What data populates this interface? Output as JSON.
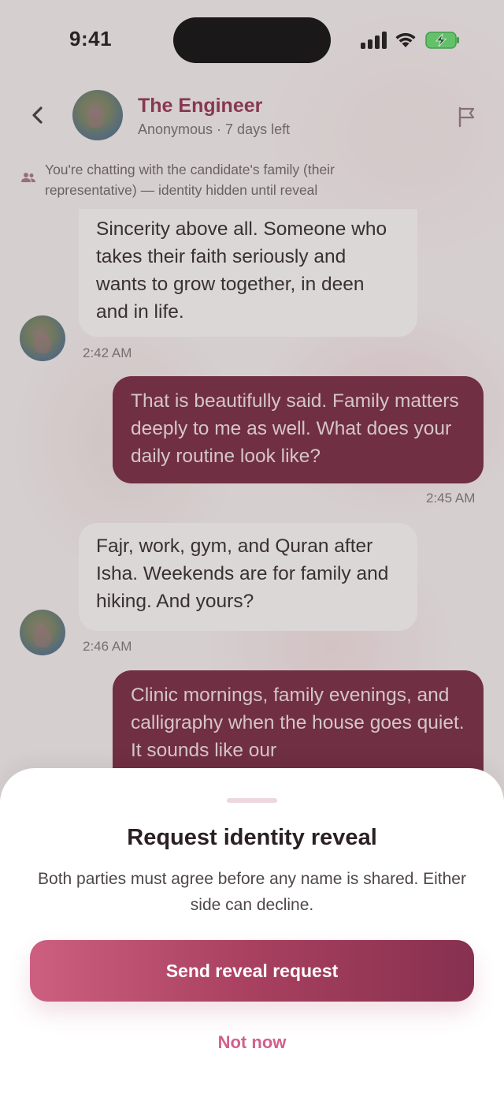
{
  "status_bar": {
    "time": "9:41"
  },
  "header": {
    "name": "The Engineer",
    "subtitle": "Anonymous · 7 days left"
  },
  "notice": {
    "text": "You're chatting with the candidate's family (their representative) — identity hidden until reveal"
  },
  "messages": [
    {
      "direction": "incoming",
      "text": "Sincerity above all. Someone who takes their faith seriously and wants to grow together, in deen and in life.",
      "time": "2:42 AM"
    },
    {
      "direction": "outgoing",
      "text": "That is beautifully said. Family matters deeply to me as well. What does your daily routine look like?",
      "time": "2:45 AM"
    },
    {
      "direction": "incoming",
      "text": "Fajr, work, gym, and Quran after Isha. Weekends are for family and hiking. And yours?",
      "time": "2:46 AM"
    },
    {
      "direction": "outgoing",
      "text": "Clinic mornings, family evenings, and calligraphy when the house goes quiet. It sounds like our"
    }
  ],
  "sheet": {
    "title": "Request identity reveal",
    "description": "Both parties must agree before any name is shared. Either side can decline.",
    "primary_label": "Send reveal request",
    "secondary_label": "Not now"
  },
  "colors": {
    "accent": "#8a2d4a",
    "outgoing_bubble": "#6e2239",
    "incoming_bubble": "#f2eeee",
    "button_gradient_start": "#cd5f80",
    "button_gradient_end": "#87304f",
    "secondary_text": "#d2608a"
  },
  "icons": [
    "back-chevron-icon",
    "flag-icon",
    "people-icon",
    "signal-icon",
    "wifi-icon",
    "battery-charging-icon"
  ]
}
